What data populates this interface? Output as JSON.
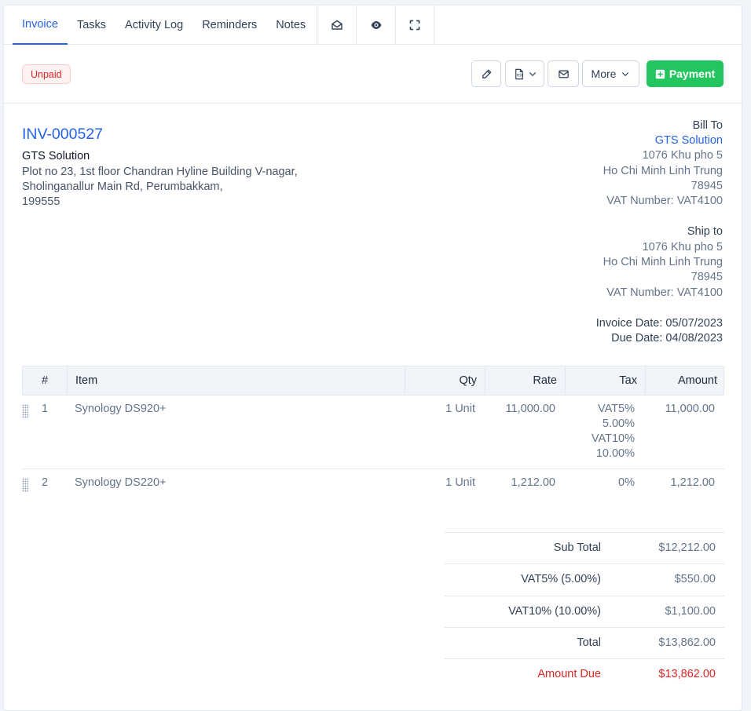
{
  "tabs": {
    "invoice": "Invoice",
    "tasks": "Tasks",
    "activity_log": "Activity Log",
    "reminders": "Reminders",
    "notes": "Notes",
    "icons": [
      "envelope-open-icon",
      "eye-icon",
      "fullscreen-icon"
    ]
  },
  "toolbar": {
    "status": "Unpaid",
    "more_label": "More",
    "payment_label": "Payment"
  },
  "invoice": {
    "number": "INV-000527",
    "company": "GTS Solution",
    "address": [
      "Plot no 23, 1st floor Chandran Hyline Building V-nagar,",
      "Sholinganallur Main Rd, Perumbakkam,",
      "199555"
    ]
  },
  "bill_to": {
    "heading": "Bill To",
    "name": "GTS Solution",
    "lines": [
      "1076 Khu pho 5",
      "Ho Chi Minh Linh Trung",
      "78945",
      "VAT Number: VAT4100"
    ]
  },
  "ship_to": {
    "heading": "Ship to",
    "lines": [
      "1076 Khu pho 5",
      "Ho Chi Minh Linh Trung",
      "78945",
      "VAT Number: VAT4100"
    ]
  },
  "dates": {
    "invoice_date": "Invoice Date: 05/07/2023",
    "due_date": "Due Date: 04/08/2023"
  },
  "table": {
    "headers": [
      "#",
      "Item",
      "Qty",
      "Rate",
      "Tax",
      "Amount"
    ],
    "rows": [
      {
        "num": "1",
        "item": "Synology DS920+",
        "qty": "1 Unit",
        "rate": "11,000.00",
        "tax": [
          "VAT5%",
          "5.00%",
          "VAT10%",
          "10.00%"
        ],
        "amount": "11,000.00"
      },
      {
        "num": "2",
        "item": "Synology DS220+",
        "qty": "1 Unit",
        "rate": "1,212.00",
        "tax": [
          "0%"
        ],
        "amount": "1,212.00"
      }
    ]
  },
  "totals": [
    {
      "label": "Sub Total",
      "value": "$12,212.00"
    },
    {
      "label": "VAT5% (5.00%)",
      "value": "$550.00"
    },
    {
      "label": "VAT10% (10.00%)",
      "value": "$1,100.00"
    },
    {
      "label": "Total",
      "value": "$13,862.00"
    },
    {
      "label": "Amount Due",
      "value": "$13,862.00"
    }
  ],
  "colors": {
    "accent": "#2563eb",
    "success": "#22c55e",
    "danger": "#dc2626"
  }
}
